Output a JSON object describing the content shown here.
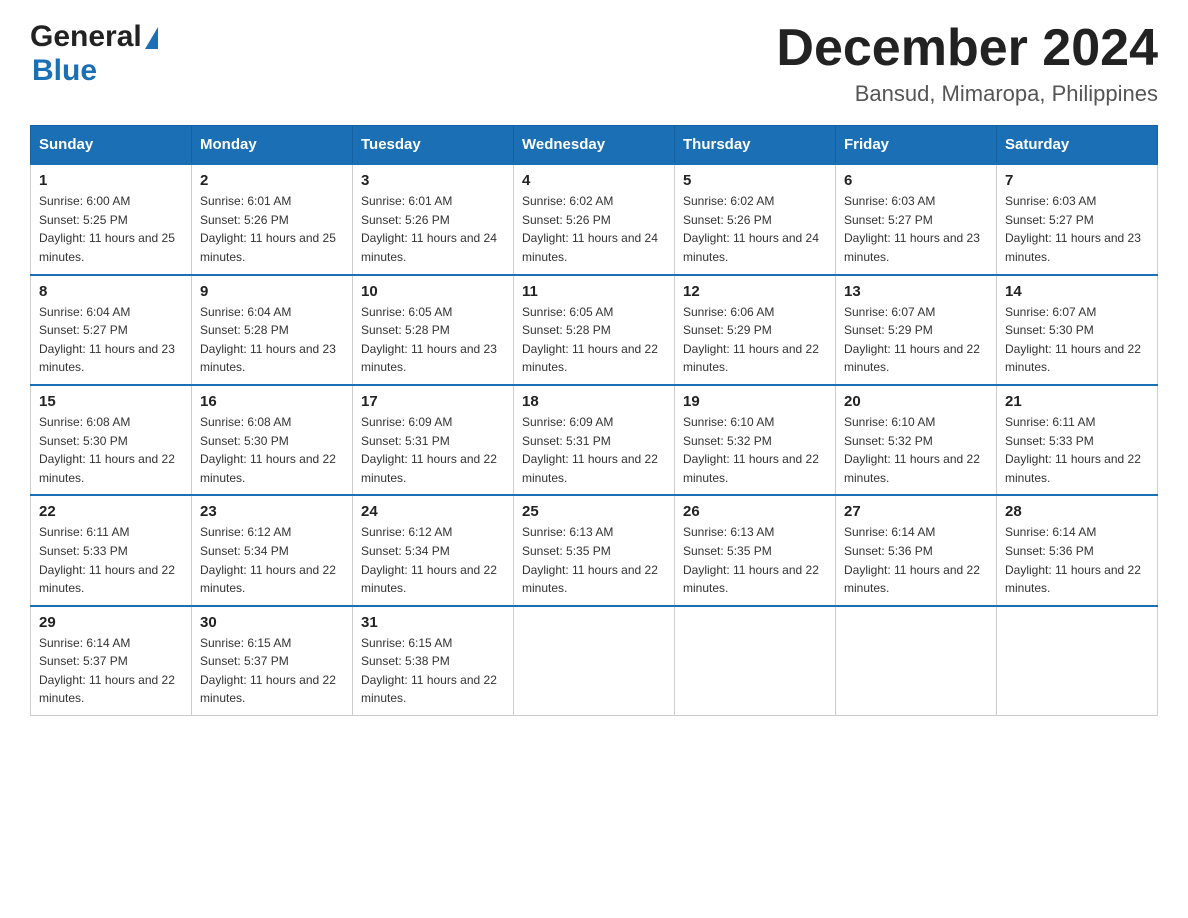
{
  "header": {
    "logo_general": "General",
    "logo_blue": "Blue",
    "month_title": "December 2024",
    "location": "Bansud, Mimaropa, Philippines"
  },
  "weekdays": [
    "Sunday",
    "Monday",
    "Tuesday",
    "Wednesday",
    "Thursday",
    "Friday",
    "Saturday"
  ],
  "weeks": [
    [
      {
        "day": "1",
        "sunrise": "6:00 AM",
        "sunset": "5:25 PM",
        "daylight": "11 hours and 25 minutes."
      },
      {
        "day": "2",
        "sunrise": "6:01 AM",
        "sunset": "5:26 PM",
        "daylight": "11 hours and 25 minutes."
      },
      {
        "day": "3",
        "sunrise": "6:01 AM",
        "sunset": "5:26 PM",
        "daylight": "11 hours and 24 minutes."
      },
      {
        "day": "4",
        "sunrise": "6:02 AM",
        "sunset": "5:26 PM",
        "daylight": "11 hours and 24 minutes."
      },
      {
        "day": "5",
        "sunrise": "6:02 AM",
        "sunset": "5:26 PM",
        "daylight": "11 hours and 24 minutes."
      },
      {
        "day": "6",
        "sunrise": "6:03 AM",
        "sunset": "5:27 PM",
        "daylight": "11 hours and 23 minutes."
      },
      {
        "day": "7",
        "sunrise": "6:03 AM",
        "sunset": "5:27 PM",
        "daylight": "11 hours and 23 minutes."
      }
    ],
    [
      {
        "day": "8",
        "sunrise": "6:04 AM",
        "sunset": "5:27 PM",
        "daylight": "11 hours and 23 minutes."
      },
      {
        "day": "9",
        "sunrise": "6:04 AM",
        "sunset": "5:28 PM",
        "daylight": "11 hours and 23 minutes."
      },
      {
        "day": "10",
        "sunrise": "6:05 AM",
        "sunset": "5:28 PM",
        "daylight": "11 hours and 23 minutes."
      },
      {
        "day": "11",
        "sunrise": "6:05 AM",
        "sunset": "5:28 PM",
        "daylight": "11 hours and 22 minutes."
      },
      {
        "day": "12",
        "sunrise": "6:06 AM",
        "sunset": "5:29 PM",
        "daylight": "11 hours and 22 minutes."
      },
      {
        "day": "13",
        "sunrise": "6:07 AM",
        "sunset": "5:29 PM",
        "daylight": "11 hours and 22 minutes."
      },
      {
        "day": "14",
        "sunrise": "6:07 AM",
        "sunset": "5:30 PM",
        "daylight": "11 hours and 22 minutes."
      }
    ],
    [
      {
        "day": "15",
        "sunrise": "6:08 AM",
        "sunset": "5:30 PM",
        "daylight": "11 hours and 22 minutes."
      },
      {
        "day": "16",
        "sunrise": "6:08 AM",
        "sunset": "5:30 PM",
        "daylight": "11 hours and 22 minutes."
      },
      {
        "day": "17",
        "sunrise": "6:09 AM",
        "sunset": "5:31 PM",
        "daylight": "11 hours and 22 minutes."
      },
      {
        "day": "18",
        "sunrise": "6:09 AM",
        "sunset": "5:31 PM",
        "daylight": "11 hours and 22 minutes."
      },
      {
        "day": "19",
        "sunrise": "6:10 AM",
        "sunset": "5:32 PM",
        "daylight": "11 hours and 22 minutes."
      },
      {
        "day": "20",
        "sunrise": "6:10 AM",
        "sunset": "5:32 PM",
        "daylight": "11 hours and 22 minutes."
      },
      {
        "day": "21",
        "sunrise": "6:11 AM",
        "sunset": "5:33 PM",
        "daylight": "11 hours and 22 minutes."
      }
    ],
    [
      {
        "day": "22",
        "sunrise": "6:11 AM",
        "sunset": "5:33 PM",
        "daylight": "11 hours and 22 minutes."
      },
      {
        "day": "23",
        "sunrise": "6:12 AM",
        "sunset": "5:34 PM",
        "daylight": "11 hours and 22 minutes."
      },
      {
        "day": "24",
        "sunrise": "6:12 AM",
        "sunset": "5:34 PM",
        "daylight": "11 hours and 22 minutes."
      },
      {
        "day": "25",
        "sunrise": "6:13 AM",
        "sunset": "5:35 PM",
        "daylight": "11 hours and 22 minutes."
      },
      {
        "day": "26",
        "sunrise": "6:13 AM",
        "sunset": "5:35 PM",
        "daylight": "11 hours and 22 minutes."
      },
      {
        "day": "27",
        "sunrise": "6:14 AM",
        "sunset": "5:36 PM",
        "daylight": "11 hours and 22 minutes."
      },
      {
        "day": "28",
        "sunrise": "6:14 AM",
        "sunset": "5:36 PM",
        "daylight": "11 hours and 22 minutes."
      }
    ],
    [
      {
        "day": "29",
        "sunrise": "6:14 AM",
        "sunset": "5:37 PM",
        "daylight": "11 hours and 22 minutes."
      },
      {
        "day": "30",
        "sunrise": "6:15 AM",
        "sunset": "5:37 PM",
        "daylight": "11 hours and 22 minutes."
      },
      {
        "day": "31",
        "sunrise": "6:15 AM",
        "sunset": "5:38 PM",
        "daylight": "11 hours and 22 minutes."
      },
      null,
      null,
      null,
      null
    ]
  ]
}
